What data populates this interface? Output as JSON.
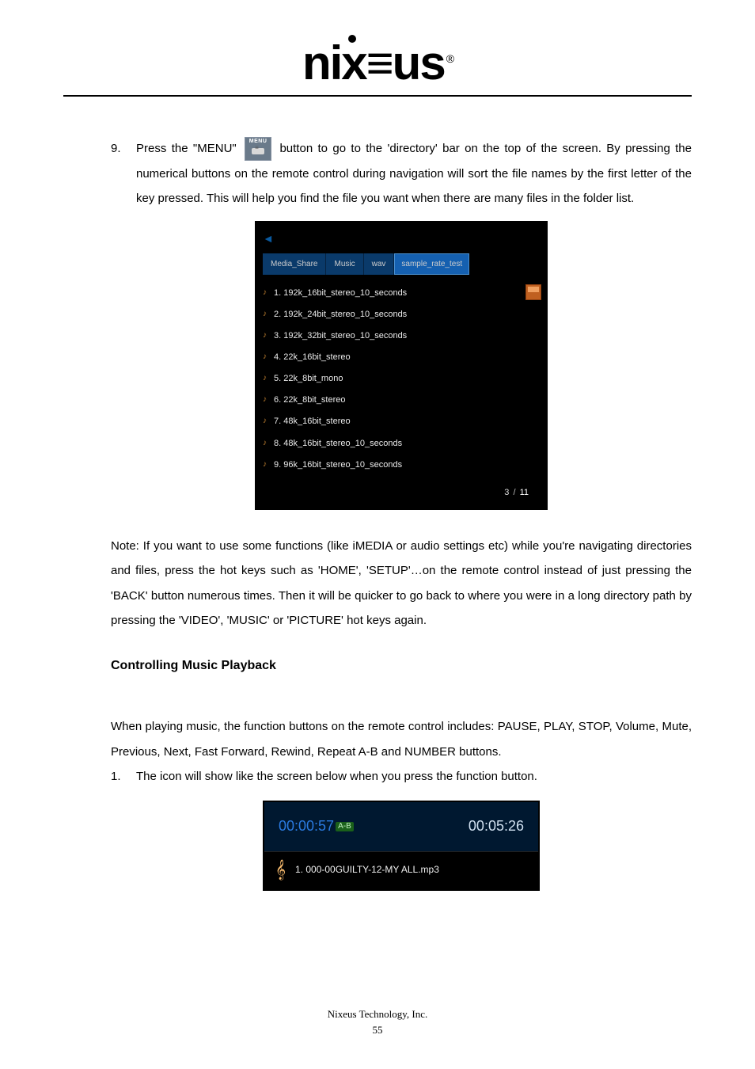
{
  "logo_text": "nix≡us",
  "logo_reg": "®",
  "step9": {
    "number": "9.",
    "text_before": "Press the \"MENU\"",
    "menu_label": "MENU",
    "text_after": " button to go to the 'directory' bar on the top of the screen. By pressing the numerical buttons on the remote control during navigation will sort the file names by the first letter of the key pressed. This will help you find the file you want when there are many files in the folder list."
  },
  "shot1": {
    "crumbs": [
      "Media_Share",
      "Music",
      "wav",
      "sample_rate_test"
    ],
    "files": [
      "1. 192k_16bit_stereo_10_seconds",
      "2. 192k_24bit_stereo_10_seconds",
      "3. 192k_32bit_stereo_10_seconds",
      "4. 22k_16bit_stereo",
      "5. 22k_8bit_mono",
      "6. 22k_8bit_stereo",
      "7. 48k_16bit_stereo",
      "8. 48k_16bit_stereo_10_seconds",
      "9. 96k_16bit_stereo_10_seconds"
    ],
    "page_current": "3",
    "page_sep": "/",
    "page_total": "11"
  },
  "note_para": "Note: If you want to use some functions (like iMEDIA or audio settings etc) while you're navigating directories and files, press the hot keys such as 'HOME', 'SETUP'…on the remote control instead of just pressing the 'BACK' button numerous times. Then it will be quicker to go back to where you were in a long directory path by pressing the 'VIDEO', 'MUSIC' or 'PICTURE' hot keys again.",
  "section_heading": "Controlling Music Playback",
  "music_intro": "When playing music, the function buttons on the remote control includes: PAUSE, PLAY, STOP, Volume, Mute, Previous, Next, Fast Forward, Rewind, Repeat A-B and NUMBER buttons.",
  "step1": {
    "number": "1.",
    "text": "The icon will show like the screen below when you press the function button."
  },
  "shot2": {
    "time_elapsed": "00:00:57",
    "ab_badge": "A-B",
    "time_total": "00:05:26",
    "track": "1. 000-00GUILTY-12-MY ALL.mp3"
  },
  "footer_company": "Nixeus Technology, Inc.",
  "footer_page": "55"
}
